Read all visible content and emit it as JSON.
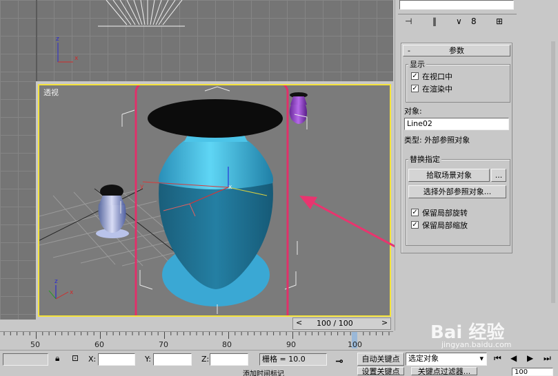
{
  "viewport": {
    "perspective_label": "透视",
    "axis_x": "x",
    "axis_z": "z",
    "axis_y": "y"
  },
  "panel": {
    "rollout_title": "参数",
    "rollout_toggle": "-",
    "display_group": "显示",
    "chk_viewport": "在视口中",
    "chk_render": "在渲染中",
    "object_label": "对象:",
    "object_value": "Line02",
    "type_text": "类型: 外部参照对象",
    "replace_group": "替换指定",
    "btn_pick_scene": "拾取场景对象",
    "btn_dots": "...",
    "btn_select_xref": "选择外部参照对象...",
    "chk_keep_rotation": "保留局部旋转",
    "chk_keep_scale": "保留局部缩放",
    "check_mark": "✓"
  },
  "timeline": {
    "frame_display": "100 / 100",
    "prev_arrow": "<",
    "next_arrow": ">",
    "ticks": [
      "50",
      "60",
      "70",
      "80",
      "90",
      "100"
    ]
  },
  "status": {
    "x_label": "X:",
    "y_label": "Y:",
    "z_label": "Z:",
    "grid_text": "栅格 = 10.0",
    "auto_key": "自动关键点",
    "selected_object": "选定对象",
    "set_key": "设置关键点",
    "key_filter": "关键点过滤器...",
    "add_time_tag": "添加时间标记",
    "frame_value": "100"
  },
  "watermark": {
    "brand": "Bai 经验",
    "url": "jingyan.baidu.com"
  },
  "colors": {
    "vase_light": "#46c6ea",
    "vase_dark": "#1b6e8d",
    "base_disc": "#3aa8d4",
    "highlight_frame": "#e0306a",
    "viewport_border": "#f5e33a",
    "arrow": "#e8356f"
  }
}
